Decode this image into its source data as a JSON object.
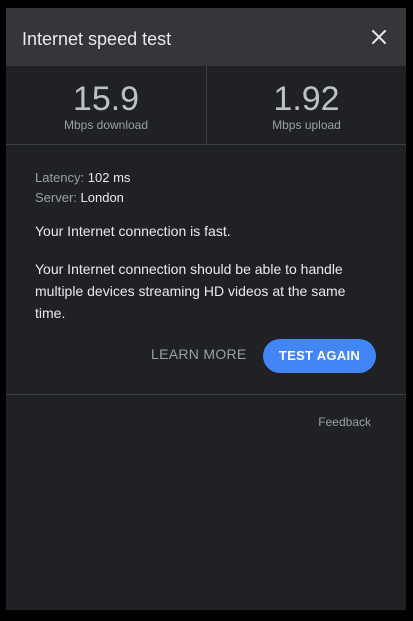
{
  "dialog": {
    "title": "Internet speed test",
    "close_icon": "close-icon"
  },
  "metrics": {
    "download": {
      "value": "15.9",
      "label": "Mbps download"
    },
    "upload": {
      "value": "1.92",
      "label": "Mbps upload"
    }
  },
  "details": {
    "latency_label": "Latency:",
    "latency_value": "102 ms",
    "server_label": "Server:",
    "server_value": "London"
  },
  "summary": "Your Internet connection is fast.",
  "description": "Your Internet connection should be able to handle multiple devices streaming HD videos at the same time.",
  "actions": {
    "learn_more": "LEARN MORE",
    "test_again": "TEST AGAIN"
  },
  "footer": {
    "feedback": "Feedback"
  },
  "colors": {
    "accent": "#4285f4",
    "background": "#202124",
    "header": "#35363a"
  }
}
